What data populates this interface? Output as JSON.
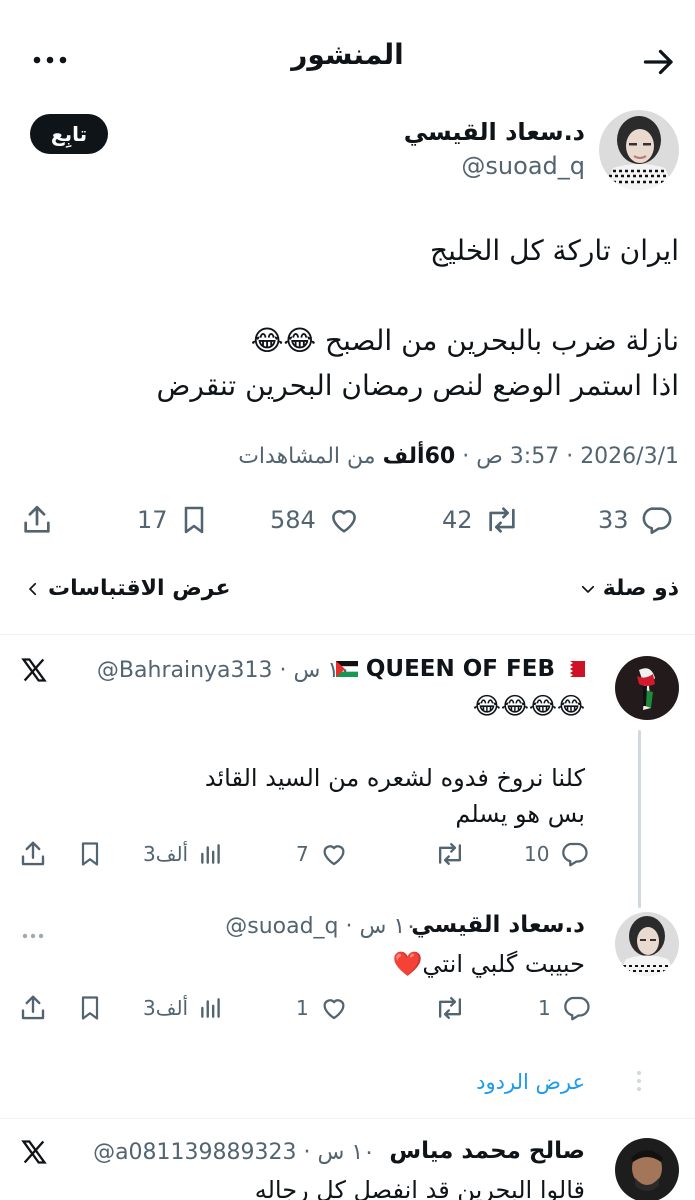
{
  "header": {
    "title": "المنشور"
  },
  "post": {
    "author_name": "د.سعاد القيسي",
    "author_handle": "@suoad_q",
    "follow_label": "تابِع",
    "text": "ايران تاركة كل الخليج\n\nنازلة ضرب بالبحرين من الصبح 😂😂\nاذا استمر الوضع لنص رمضان البحرين تنقرض",
    "date": "2026/3/1",
    "time": "3:57 ص",
    "views_count": "60ألف",
    "views_label": "من المشاهدات",
    "replies": "33",
    "reposts": "42",
    "likes": "584",
    "bookmarks": "17"
  },
  "filters": {
    "variant_label": "ذو صلة",
    "quotes_label": "عرض الاقتباسات"
  },
  "replies": [
    {
      "name": "QUEEN OF FEB",
      "handle_time": "@Bahrainya313 · ١٠ س",
      "text": "😂😂😂😂\n\nكلنا نروخ فدوه لشعره من السيد القائد\nبس هو يسلم",
      "replies": "10",
      "reposts": "",
      "likes": "7",
      "views": "3ألف"
    },
    {
      "name": "د.سعاد القيسي",
      "handle_time": "@suoad_q · ١٠ س",
      "text": "حبيبت گلبي انتي❤️",
      "replies": "1",
      "reposts": "",
      "likes": "1",
      "views": "3ألف",
      "show_replies": "عرض الردود"
    },
    {
      "name": "صالح محمد مياس",
      "handle_time": "@a081139889323 · ١٠ س",
      "text": "قالوا البحرين قد انفصل كل رجاله"
    }
  ],
  "icons": [
    "back-arrow-icon",
    "more-icon",
    "reply-icon",
    "repost-icon",
    "like-icon",
    "bookmark-icon",
    "share-icon",
    "views-icon",
    "x-logo-icon",
    "chevron-down-icon",
    "chevron-left-icon"
  ]
}
